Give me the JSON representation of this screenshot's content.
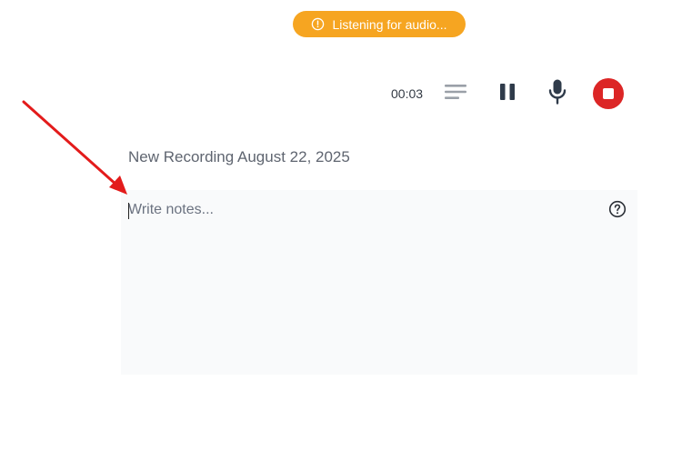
{
  "status": {
    "text": "Listening for audio...",
    "icon": "alert-circle-icon",
    "color": "#f6a521"
  },
  "toolbar": {
    "timer": "00:03",
    "transcript_icon": "lines-icon",
    "pause_icon": "pause-icon",
    "mic_icon": "microphone-icon",
    "stop_icon": "stop-icon",
    "stop_color": "#dc2626"
  },
  "recording": {
    "title": "New Recording August 22, 2025"
  },
  "notes": {
    "placeholder": "Write notes...",
    "value": "",
    "help_icon": "help-circle-icon"
  },
  "annotation": {
    "icon": "red-arrow-icon",
    "color": "#e31b1b"
  }
}
